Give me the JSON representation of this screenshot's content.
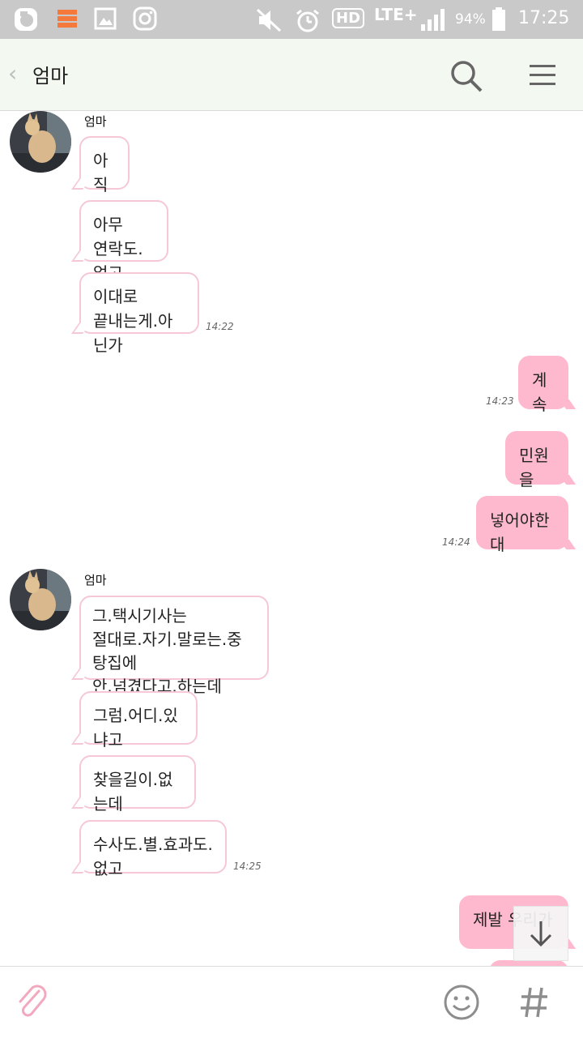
{
  "header": {
    "back_icon": "chevron-left-icon",
    "title": "엄마",
    "search_icon": "search-icon",
    "menu_icon": "menu-icon"
  },
  "statusbar": {
    "battery": "94%",
    "time": "17:25",
    "network": "LTE+",
    "hd": "HD"
  },
  "chat": {
    "sender_1": "엄마",
    "in_1": [
      "아직",
      "아무\n연락도.없고",
      "이대로\n끝내는게.아닌가"
    ],
    "time_1": "14:22",
    "out_1": [
      "계속"
    ],
    "time_2": "14:23",
    "out_2": [
      "민원을",
      "넣어야한대"
    ],
    "time_3": "14:24",
    "sender_2": "엄마",
    "in_2": [
      "그.택시기사는\n절대로.자기.말로는.중탕집에\n안.넘겼다고.하는데",
      "그럼.어디.있냐고",
      "찾을길이.없는데",
      "수사도.별.효과도.없고"
    ],
    "time_4": "14:25",
    "out_3": [
      "제발 우리가"
    ]
  },
  "bottom": {
    "attach_icon": "paperclip-icon",
    "emoji_icon": "smiley-icon",
    "hash_icon": "hashtag-icon"
  },
  "colors": {
    "bubble_out": "#ffb9ce",
    "bubble_in_border": "#f6c8d6",
    "header_bg": "#f3f8f1",
    "statusbar_bg": "#c9c9c9"
  }
}
